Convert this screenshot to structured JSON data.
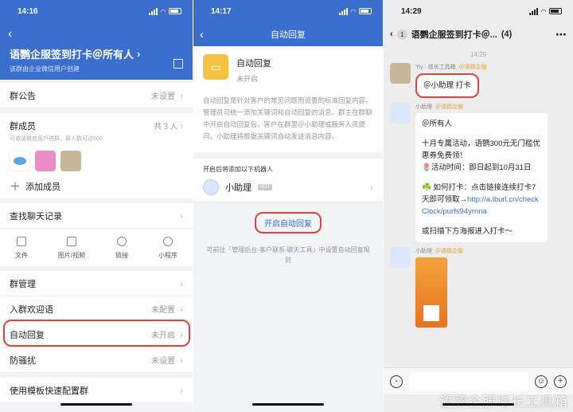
{
  "p1": {
    "time": "14:16",
    "title": "语鹦企服签到打卡＠所有人",
    "subtitle": "该群由企业微信用户创建",
    "announce_label": "群公告",
    "announce_val": "未设置",
    "members_label": "群成员",
    "members_count": "共３人",
    "members_sub": "可邀请微信用户进群，群人数可达500",
    "add_member": "添加成员",
    "search_history": "查找聊天记录",
    "tools": [
      "文件",
      "图片/视频",
      "链接",
      "小程序"
    ],
    "manage": "群管理",
    "welcome_label": "入群欢迎语",
    "welcome_val": "未配置",
    "autoreply_label": "自动回复",
    "autoreply_val": "未开启",
    "antispam_label": "防骚扰",
    "antispam_val": "未设置",
    "template_label": "使用模板快速配置群"
  },
  "p2": {
    "time": "14:17",
    "title": "自动回复",
    "feature_name": "自动回复",
    "feature_state": "未开启",
    "desc": "自动回复是针对客户的常见问题而设置的标准回复内容。管理员可统一添加关键词和自动回复的消息。群主在群聊中开启自动回复后，客户在群里＠小助理或服务人员提问，小助理将根据关键词自动发送消息内容。",
    "robots_label": "开启后将添加以下机器人",
    "robot_name": "小助理",
    "robot_tag": "BOT",
    "enable_btn": "开启自动回复",
    "footer": "可前往「管理后台-客户联系-聊天工具」中设置自动回复规则"
  },
  "p3": {
    "time": "14:29",
    "back_count": "1",
    "title": "语鹦企服签到打卡＠...",
    "member_count": "(4)",
    "msg_time": "14:29",
    "sender1": "Yiy · 增长工具箱",
    "sender1_org": "＠语鹦企服",
    "msg1": "＠小助理 打卡",
    "sender2": "小助理",
    "sender2_org": "＠语鹦企服",
    "msg2_l1": "＠所有人",
    "msg2_l2": "十月专属活动，语鹦300元无门槛优惠券免费领！",
    "msg2_l3": "🌷活动时间：即日起到10月31日",
    "msg2_l4": "☘️ 如何打卡：点击链接连续打卡7天即可领取→",
    "msg2_link": "http://a.lburl.cn/checkClock/purfs94yrnna",
    "msg2_l5": "或扫描下方海报进入打卡～",
    "sender3": "小助理",
    "sender3_org": "＠语鹦企服",
    "watermark": "语鹦企服增长工具箱"
  }
}
